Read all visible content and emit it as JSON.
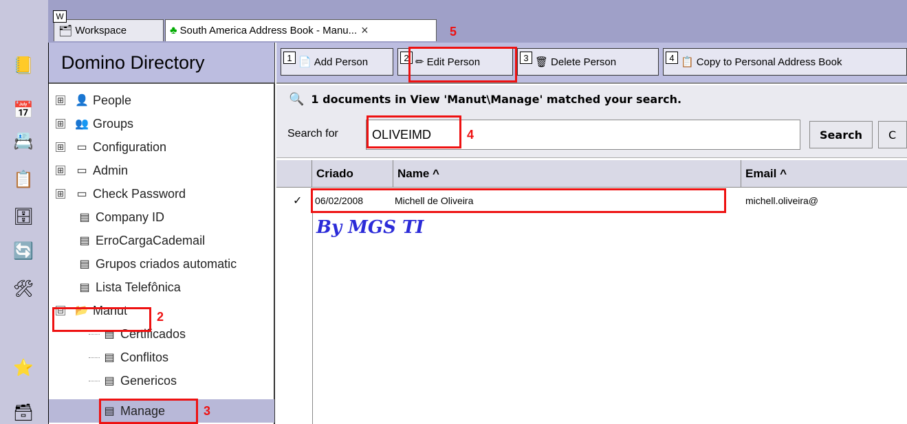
{
  "tabs": [
    {
      "label": "Workspace",
      "badge": "W"
    },
    {
      "label": "South America Address Book - Manu...",
      "close": "×"
    }
  ],
  "panel": {
    "title": "Domino Directory",
    "nav": [
      {
        "label": "People",
        "expand": "⊞"
      },
      {
        "label": "Groups",
        "expand": "⊞"
      },
      {
        "label": "Configuration",
        "expand": "⊞"
      },
      {
        "label": "Admin",
        "expand": "⊞"
      },
      {
        "label": "Check Password",
        "expand": "⊞"
      },
      {
        "label": "Company ID"
      },
      {
        "label": "ErroCargaCademail"
      },
      {
        "label": "Grupos criados automatic"
      },
      {
        "label": "Lista Telefônica"
      },
      {
        "label": "Manut",
        "expand": "⊟"
      },
      {
        "label": "Certificados"
      },
      {
        "label": "Conflitos"
      },
      {
        "label": "Genericos"
      },
      {
        "label": "Manage"
      }
    ]
  },
  "actions": [
    {
      "num": "1",
      "label": "Add Person"
    },
    {
      "num": "2",
      "label": "Edit Person"
    },
    {
      "num": "3",
      "label": "Delete Person"
    },
    {
      "num": "4",
      "label": "Copy to Personal Address Book"
    }
  ],
  "status": {
    "text": "1 documents in View 'Manut\\Manage' matched your search."
  },
  "search": {
    "label": "Search for",
    "value": "OLIVEIMD",
    "button": "Search",
    "clear_fragment": "C"
  },
  "columns": [
    {
      "label": "Criado"
    },
    {
      "label": "Name ^"
    },
    {
      "label": "Email ^"
    }
  ],
  "rows": [
    {
      "check": "✓",
      "criado": "06/02/2008",
      "name": "Michell de Oliveira",
      "email": "michell.oliveira@"
    }
  ],
  "watermark": "By MGS TI",
  "annotations": {
    "a2": "2",
    "a3": "3",
    "a4": "4",
    "a5": "5"
  },
  "colors": {
    "annotation": "#e11111",
    "panel_header": "#bcbde0",
    "tab_bar": "#9fa0c8",
    "selection": "#b8b8d8"
  }
}
